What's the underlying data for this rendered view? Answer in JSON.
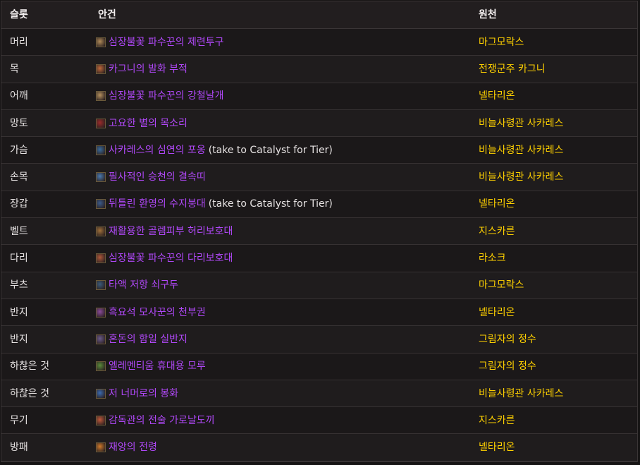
{
  "header": {
    "slot": "슬롯",
    "item": "안건",
    "source": "원천"
  },
  "rows": [
    {
      "slot": "머리",
      "item": "심장불꽃 파수꾼의 제련투구",
      "note": "",
      "source": "마그모락스",
      "icon": "helm-icon",
      "icon_color": "#b08a58"
    },
    {
      "slot": "목",
      "item": "카그니의 발화 부적",
      "note": "",
      "source": "전쟁군주 카그니",
      "icon": "amulet-icon",
      "icon_color": "#c0683a"
    },
    {
      "slot": "어깨",
      "item": "심장불꽃 파수꾼의 강철날개",
      "note": "",
      "source": "넬타리온",
      "icon": "shoulder-icon",
      "icon_color": "#b5915e"
    },
    {
      "slot": "망토",
      "item": "고요한 별의 목소리",
      "note": "",
      "source": "비늘사령관 사카레스",
      "icon": "cloak-icon",
      "icon_color": "#9a2a2a"
    },
    {
      "slot": "가슴",
      "item": "사카레스의 심연의 포옹",
      "note": "(take to Catalyst for Tier)",
      "source": "비늘사령관 사카레스",
      "icon": "chest-icon",
      "icon_color": "#3a6a9a"
    },
    {
      "slot": "손목",
      "item": "필사적인 승천의 결속띠",
      "note": "",
      "source": "비늘사령관 사카레스",
      "icon": "bracer-icon",
      "icon_color": "#4a7ab0"
    },
    {
      "slot": "장갑",
      "item": "뒤틀린 환영의 수지붕대",
      "note": "(take to Catalyst for Tier)",
      "source": "넬타리온",
      "icon": "gloves-icon",
      "icon_color": "#3a5a8a"
    },
    {
      "slot": "벨트",
      "item": "재활용한 골렘피부 허리보호대",
      "note": "",
      "source": "지스카른",
      "icon": "belt-icon",
      "icon_color": "#a0703a"
    },
    {
      "slot": "다리",
      "item": "심장불꽃 파수꾼의 다리보호대",
      "note": "",
      "source": "라소크",
      "icon": "legs-icon",
      "icon_color": "#b0583a"
    },
    {
      "slot": "부츠",
      "item": "타액 저항 쇠구두",
      "note": "",
      "source": "마그모락스",
      "icon": "boots-icon",
      "icon_color": "#3a5a7a"
    },
    {
      "slot": "반지",
      "item": "흑요석 모사꾼의 천부권",
      "note": "",
      "source": "넬타리온",
      "icon": "ring-icon",
      "icon_color": "#8a4a9a"
    },
    {
      "slot": "반지",
      "item": "혼돈의 함일 실반지",
      "note": "",
      "source": "그림자의 정수",
      "icon": "ring-icon",
      "icon_color": "#6a5a8a"
    },
    {
      "slot": "하찮은 것",
      "item": "엘레멘티움 휴대용 모루",
      "note": "",
      "source": "그림자의 정수",
      "icon": "trinket-icon",
      "icon_color": "#5a8a3a"
    },
    {
      "slot": "하찮은 것",
      "item": "저 너머로의 봉화",
      "note": "",
      "source": "비늘사령관 사카레스",
      "icon": "trinket-icon",
      "icon_color": "#3a6ab0"
    },
    {
      "slot": "무기",
      "item": "감독관의 전술 가로날도끼",
      "note": "",
      "source": "지스카른",
      "icon": "axe-icon",
      "icon_color": "#c0583a"
    },
    {
      "slot": "방패",
      "item": "재앙의 전령",
      "note": "",
      "source": "넬타리온",
      "icon": "shield-icon",
      "icon_color": "#d07a2a"
    }
  ]
}
